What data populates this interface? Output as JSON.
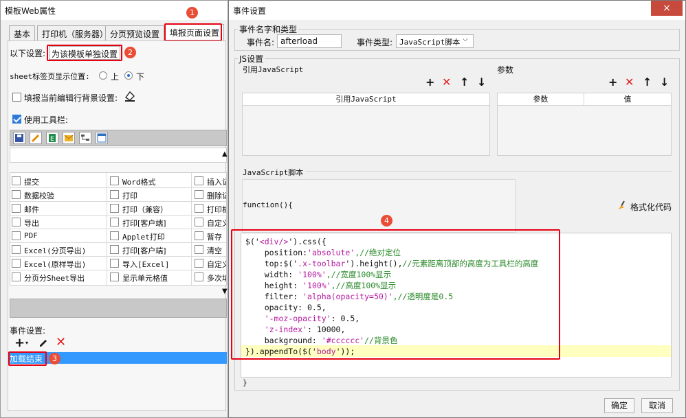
{
  "left_window": {
    "title": "模板Web属性",
    "tabs": [
      "基本",
      "打印机（服务器）",
      "分页预览设置",
      "填报页面设置"
    ],
    "setting_label": "以下设置:",
    "setting_value": "为该模板单独设置",
    "sheet_tab_label": "sheet标签页显示位置:",
    "sheet_tab_options": [
      "上",
      "下"
    ],
    "sheet_tab_selected": "下",
    "edit_row_bg_label": "填报当前编辑行背景设置:",
    "use_toolbar_label": "使用工具栏:",
    "toolbar_buttons": [
      [
        "提交",
        "Word格式",
        "插入记"
      ],
      [
        "数据校验",
        "打印",
        "删除记"
      ],
      [
        "邮件",
        "打印（兼容）",
        "打印机"
      ],
      [
        "导出",
        "打印[客户端]",
        "自定义"
      ],
      [
        "PDF",
        "Applet打印",
        "暂存"
      ],
      [
        "Excel(分页导出)",
        "打印[客户端]",
        "清空"
      ],
      [
        "Excel(原样导出)",
        "导入[Excel]",
        "自定义"
      ],
      [
        "分页分Sheet导出",
        "显示单元格值",
        "多次填"
      ]
    ],
    "event_label": "事件设置:",
    "event_item": "加载结束"
  },
  "annotations": [
    "1",
    "2",
    "3",
    "4"
  ],
  "dialog": {
    "title": "事件设置",
    "close_icon": "×",
    "group_name_type": "事件名字和类型",
    "event_name_label": "事件名:",
    "event_name_value": "afterload",
    "event_type_label": "事件类型:",
    "event_type_value": "JavaScript脚本",
    "group_js": "JS设置",
    "ref_js_label": "引用JavaScript",
    "ref_js_header": "引用JavaScript",
    "params_label": "参数",
    "params_headers": [
      "参数",
      "值"
    ],
    "script_label": "JavaScript脚本",
    "function_header": "function(){",
    "format_button": "格式化代码",
    "closing_brace": "}",
    "ok_button": "确定",
    "cancel_button": "取消",
    "code_lines": [
      [
        {
          "t": "$('",
          "c": "fn"
        },
        {
          "t": "<div/>",
          "c": "str"
        },
        {
          "t": "').css({",
          "c": "fn"
        }
      ],
      [
        {
          "t": "    position:",
          "c": "fn"
        },
        {
          "t": "'absolute'",
          "c": "str"
        },
        {
          "t": ",//绝对定位",
          "c": "com"
        }
      ],
      [
        {
          "t": "    top:$('",
          "c": "fn"
        },
        {
          "t": ".x-toolbar",
          "c": "str"
        },
        {
          "t": "').height(),",
          "c": "fn"
        },
        {
          "t": "//元素距离顶部的高度为工具栏的高度",
          "c": "com"
        }
      ],
      [
        {
          "t": "    width: ",
          "c": "fn"
        },
        {
          "t": "'100%'",
          "c": "str"
        },
        {
          "t": ",//宽度100%显示",
          "c": "com"
        }
      ],
      [
        {
          "t": "    height: ",
          "c": "fn"
        },
        {
          "t": "'100%'",
          "c": "str"
        },
        {
          "t": ",//高度100%显示",
          "c": "com"
        }
      ],
      [
        {
          "t": "    filter: ",
          "c": "fn"
        },
        {
          "t": "'alpha(opacity=50)'",
          "c": "str"
        },
        {
          "t": ",//透明度是0.5",
          "c": "com"
        }
      ],
      [
        {
          "t": "    opacity: 0.5,",
          "c": "fn"
        }
      ],
      [
        {
          "t": "    ",
          "c": "fn"
        },
        {
          "t": "'-moz-opacity'",
          "c": "str"
        },
        {
          "t": ": 0.5,",
          "c": "fn"
        }
      ],
      [
        {
          "t": "    ",
          "c": "fn"
        },
        {
          "t": "'z-index'",
          "c": "str"
        },
        {
          "t": ": 10000,",
          "c": "fn"
        }
      ],
      [
        {
          "t": "    background: ",
          "c": "fn"
        },
        {
          "t": "'#cccccc'",
          "c": "str"
        },
        {
          "t": "//背景色",
          "c": "com"
        }
      ],
      [
        {
          "t": "}).appendTo($('",
          "c": "fn"
        },
        {
          "t": "body",
          "c": "str"
        },
        {
          "t": "'));",
          "c": "fn"
        }
      ]
    ]
  },
  "colors": {
    "annotation_red": "#e60012",
    "badge": "#e94d36",
    "selection": "#3399ff",
    "highlight_line": "#ffffc0"
  }
}
